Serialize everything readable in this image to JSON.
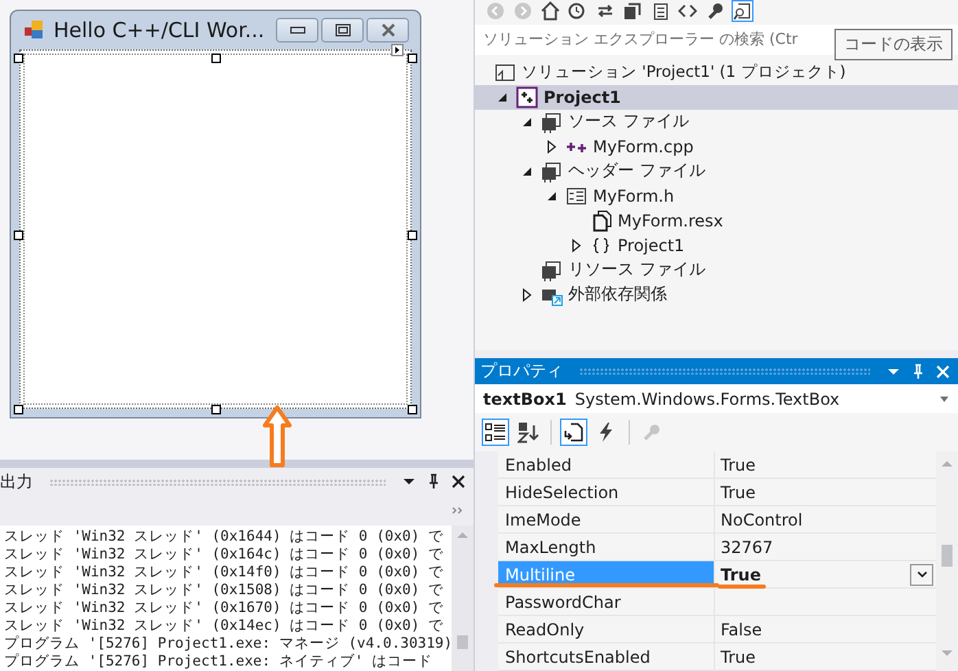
{
  "form_designer": {
    "form_title": "Hello C++/CLI Wor..."
  },
  "output": {
    "title": "出力",
    "lines": [
      "スレッド 'Win32 スレッド' (0x1644) はコード 0 (0x0) で",
      "スレッド 'Win32 スレッド' (0x164c) はコード 0 (0x0) で",
      "スレッド 'Win32 スレッド' (0x14f0) はコード 0 (0x0) で",
      "スレッド 'Win32 スレッド' (0x1508) はコード 0 (0x0) で",
      "スレッド 'Win32 スレッド' (0x1670) はコード 0 (0x0) で",
      "スレッド 'Win32 スレッド' (0x14ec) はコード 0 (0x0) で",
      "プログラム '[5276] Project1.exe: マネージ (v4.0.30319)",
      "プログラム '[5276] Project1.exe: ネイティブ' はコード"
    ]
  },
  "solution_explorer": {
    "toolbar": [
      {
        "kind": "back",
        "disabled": true
      },
      {
        "kind": "forward",
        "disabled": true
      },
      {
        "kind": "home",
        "disabled": false
      },
      {
        "kind": "history",
        "disabled": false
      },
      {
        "kind": "sync",
        "disabled": false
      },
      {
        "kind": "collapse",
        "disabled": false
      },
      {
        "kind": "files",
        "disabled": false
      },
      {
        "kind": "code",
        "disabled": false
      },
      {
        "kind": "wrench",
        "disabled": false
      },
      {
        "kind": "view",
        "disabled": false
      }
    ],
    "search": {
      "placeholder": "ソリューション エクスプローラー の検索 (Ctr"
    },
    "tooltip": "コードの表示",
    "root": {
      "label": "ソリューション 'Project1' (1 プロジェクト)",
      "kind": "solution"
    },
    "tree": [
      {
        "label": "Project1",
        "kind": "project",
        "expanded": true,
        "selected": true,
        "children": [
          {
            "label": "ソース ファイル",
            "kind": "filter",
            "expanded": true,
            "selected": false,
            "children": [
              {
                "label": "MyForm.cpp",
                "kind": "cpp",
                "expanded": false,
                "selected": false
              }
            ]
          },
          {
            "label": "ヘッダー ファイル",
            "kind": "filter",
            "expanded": true,
            "selected": false,
            "children": [
              {
                "label": "MyForm.h",
                "kind": "header",
                "expanded": true,
                "selected": false,
                "children": [
                  {
                    "label": "MyForm.resx",
                    "kind": "resx",
                    "selected": false
                  },
                  {
                    "label": "Project1",
                    "kind": "namespace",
                    "expanded": false,
                    "selected": false
                  }
                ]
              }
            ]
          },
          {
            "label": "リソース ファイル",
            "kind": "filter",
            "selected": false
          },
          {
            "label": "外部依存関係",
            "kind": "references",
            "expanded": false,
            "selected": false
          }
        ]
      }
    ]
  },
  "properties": {
    "title": "プロパティ",
    "object_name": "textBox1",
    "object_type": "System.Windows.Forms.TextBox",
    "toolbar": [
      {
        "kind": "categorized",
        "selected": true,
        "disabled": false
      },
      {
        "kind": "alphabetical",
        "selected": false,
        "disabled": false
      },
      {
        "kind": "properties",
        "selected": true,
        "disabled": false
      },
      {
        "kind": "events",
        "selected": false,
        "disabled": false
      },
      {
        "kind": "pages",
        "selected": false,
        "disabled": true
      }
    ],
    "rows": [
      {
        "name": "Enabled",
        "value": "True",
        "selected": false,
        "modified": false,
        "underlined": false
      },
      {
        "name": "HideSelection",
        "value": "True",
        "selected": false,
        "modified": false,
        "underlined": false
      },
      {
        "name": "ImeMode",
        "value": "NoControl",
        "selected": false,
        "modified": false,
        "underlined": false
      },
      {
        "name": "MaxLength",
        "value": "32767",
        "selected": false,
        "modified": false,
        "underlined": false
      },
      {
        "name": "Multiline",
        "value": "True",
        "selected": true,
        "modified": true,
        "underlined": true
      },
      {
        "name": "PasswordChar",
        "value": "",
        "selected": false,
        "modified": false,
        "underlined": false
      },
      {
        "name": "ReadOnly",
        "value": "False",
        "selected": false,
        "modified": false,
        "underlined": false
      },
      {
        "name": "ShortcutsEnabled",
        "value": "True",
        "selected": false,
        "modified": false,
        "underlined": false
      }
    ]
  }
}
